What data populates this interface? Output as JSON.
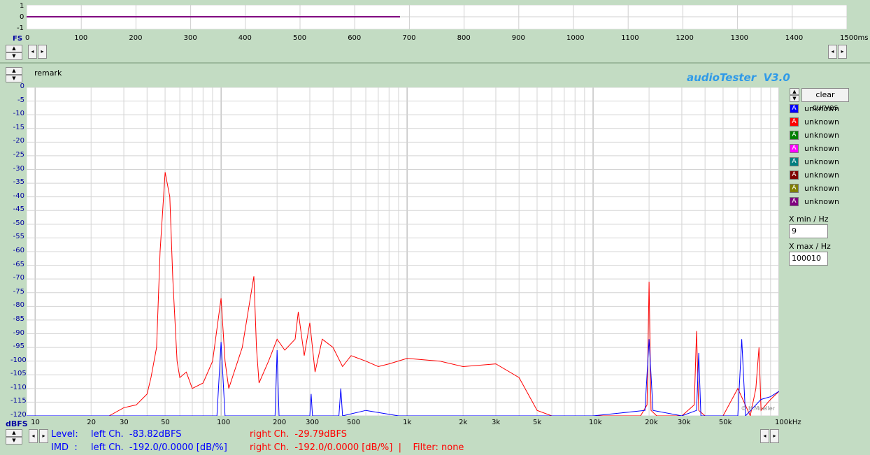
{
  "top_panel": {
    "y_ticks": [
      "1",
      "0",
      "-1"
    ],
    "fs_label": "FS",
    "x_ticks": [
      "0",
      "100",
      "200",
      "300",
      "400",
      "500",
      "600",
      "700",
      "800",
      "900",
      "1000",
      "1100",
      "1200",
      "1300",
      "1400",
      "1500ms"
    ]
  },
  "remark_label": "remark",
  "app_title": "audioTester  V3.0",
  "clear_curves_label": "clear curves",
  "legend": [
    {
      "label": "unknown",
      "color": "#0000ff",
      "glyph": "A"
    },
    {
      "label": "unknown",
      "color": "#ff0000",
      "glyph": "A"
    },
    {
      "label": "unknown",
      "color": "#008000",
      "glyph": "A"
    },
    {
      "label": "unknown",
      "color": "#ff00ff",
      "glyph": "A"
    },
    {
      "label": "unknown",
      "color": "#008080",
      "glyph": "A"
    },
    {
      "label": "unknown",
      "color": "#800000",
      "glyph": "A"
    },
    {
      "label": "unknown",
      "color": "#808000",
      "glyph": "A"
    },
    {
      "label": "unknown",
      "color": "#800080",
      "glyph": "A"
    }
  ],
  "xmin": {
    "label": "X min / Hz",
    "value": "9"
  },
  "xmax": {
    "label": "X max / Hz",
    "value": "100010"
  },
  "copyright": "© H.Mueller",
  "main_chart": {
    "y_unit": "dBFS",
    "y_ticks": [
      "0",
      "-5",
      "-10",
      "-15",
      "-20",
      "-25",
      "-30",
      "-35",
      "-40",
      "-45",
      "-50",
      "-55",
      "-60",
      "-65",
      "-70",
      "-75",
      "-80",
      "-85",
      "-90",
      "-95",
      "-100",
      "-105",
      "-110",
      "-115",
      "-120"
    ],
    "x_ticks": [
      "10",
      "20",
      "30",
      "50",
      "100",
      "200",
      "300",
      "500",
      "1k",
      "2k",
      "3k",
      "5k",
      "10k",
      "20k",
      "30k",
      "50k",
      "100kHz"
    ]
  },
  "status": {
    "level_label": "Level:",
    "imd_label": "IMD  :",
    "level_left": "left Ch.  -83.82dBFS",
    "level_right": "right Ch.  -29.79dBFS",
    "imd_left": "left Ch.  -192.0/0.0000 [dB/%]",
    "imd_right": "right Ch.  -192.0/0.0000 [dB/%]  |    Filter: none"
  },
  "chart_data": {
    "type": "line",
    "xscale": "log",
    "xlim": [
      9,
      100010
    ],
    "ylim": [
      -120,
      0
    ],
    "xlabel": "",
    "ylabel": "dBFS",
    "grid": true,
    "series": [
      {
        "color": "#ff0000",
        "x": [
          9,
          25,
          30,
          35,
          40,
          42,
          45,
          47,
          50,
          53,
          55,
          58,
          60,
          65,
          70,
          80,
          90,
          100,
          105,
          110,
          130,
          150,
          155,
          160,
          180,
          200,
          220,
          250,
          260,
          280,
          300,
          320,
          350,
          400,
          450,
          500,
          600,
          700,
          800,
          1000,
          1500,
          2000,
          3000,
          4000,
          5000,
          6000,
          8000,
          10000,
          15000,
          18000,
          19500,
          20000,
          20500,
          22000,
          30000,
          35000,
          36000,
          37000,
          40000,
          50000,
          60000,
          70000,
          75000,
          78000,
          80000,
          90000,
          100010
        ],
        "y": [
          -120,
          -120,
          -117,
          -116,
          -112,
          -106,
          -95,
          -60,
          -31,
          -40,
          -70,
          -100,
          -106,
          -104,
          -110,
          -108,
          -100,
          -77,
          -100,
          -110,
          -95,
          -69,
          -95,
          -108,
          -100,
          -92,
          -96,
          -92,
          -82,
          -98,
          -86,
          -104,
          -92,
          -95,
          -102,
          -98,
          -100,
          -102,
          -101,
          -99,
          -100,
          -102,
          -101,
          -106,
          -118,
          -120,
          -120,
          -120,
          -120,
          -120,
          -116,
          -71,
          -118,
          -120,
          -120,
          -116,
          -89,
          -118,
          -120,
          -120,
          -110,
          -120,
          -110,
          -95,
          -118,
          -114,
          -111
        ]
      },
      {
        "color": "#0000ff",
        "x": [
          9,
          30,
          50,
          95,
          100,
          105,
          110,
          195,
          200,
          205,
          300,
          305,
          310,
          430,
          440,
          450,
          600,
          900,
          1000,
          2000,
          5000,
          10000,
          19000,
          20000,
          21000,
          30000,
          36000,
          37000,
          38000,
          60000,
          63000,
          66000,
          80000,
          90000,
          100010
        ],
        "y": [
          -120,
          -120,
          -120,
          -120,
          -93,
          -120,
          -120,
          -120,
          -96,
          -120,
          -120,
          -112,
          -120,
          -120,
          -110,
          -120,
          -118,
          -120,
          -120,
          -120,
          -120,
          -120,
          -118,
          -92,
          -118,
          -120,
          -118,
          -97,
          -120,
          -120,
          -92,
          -120,
          -114,
          -113,
          -111
        ]
      }
    ]
  }
}
